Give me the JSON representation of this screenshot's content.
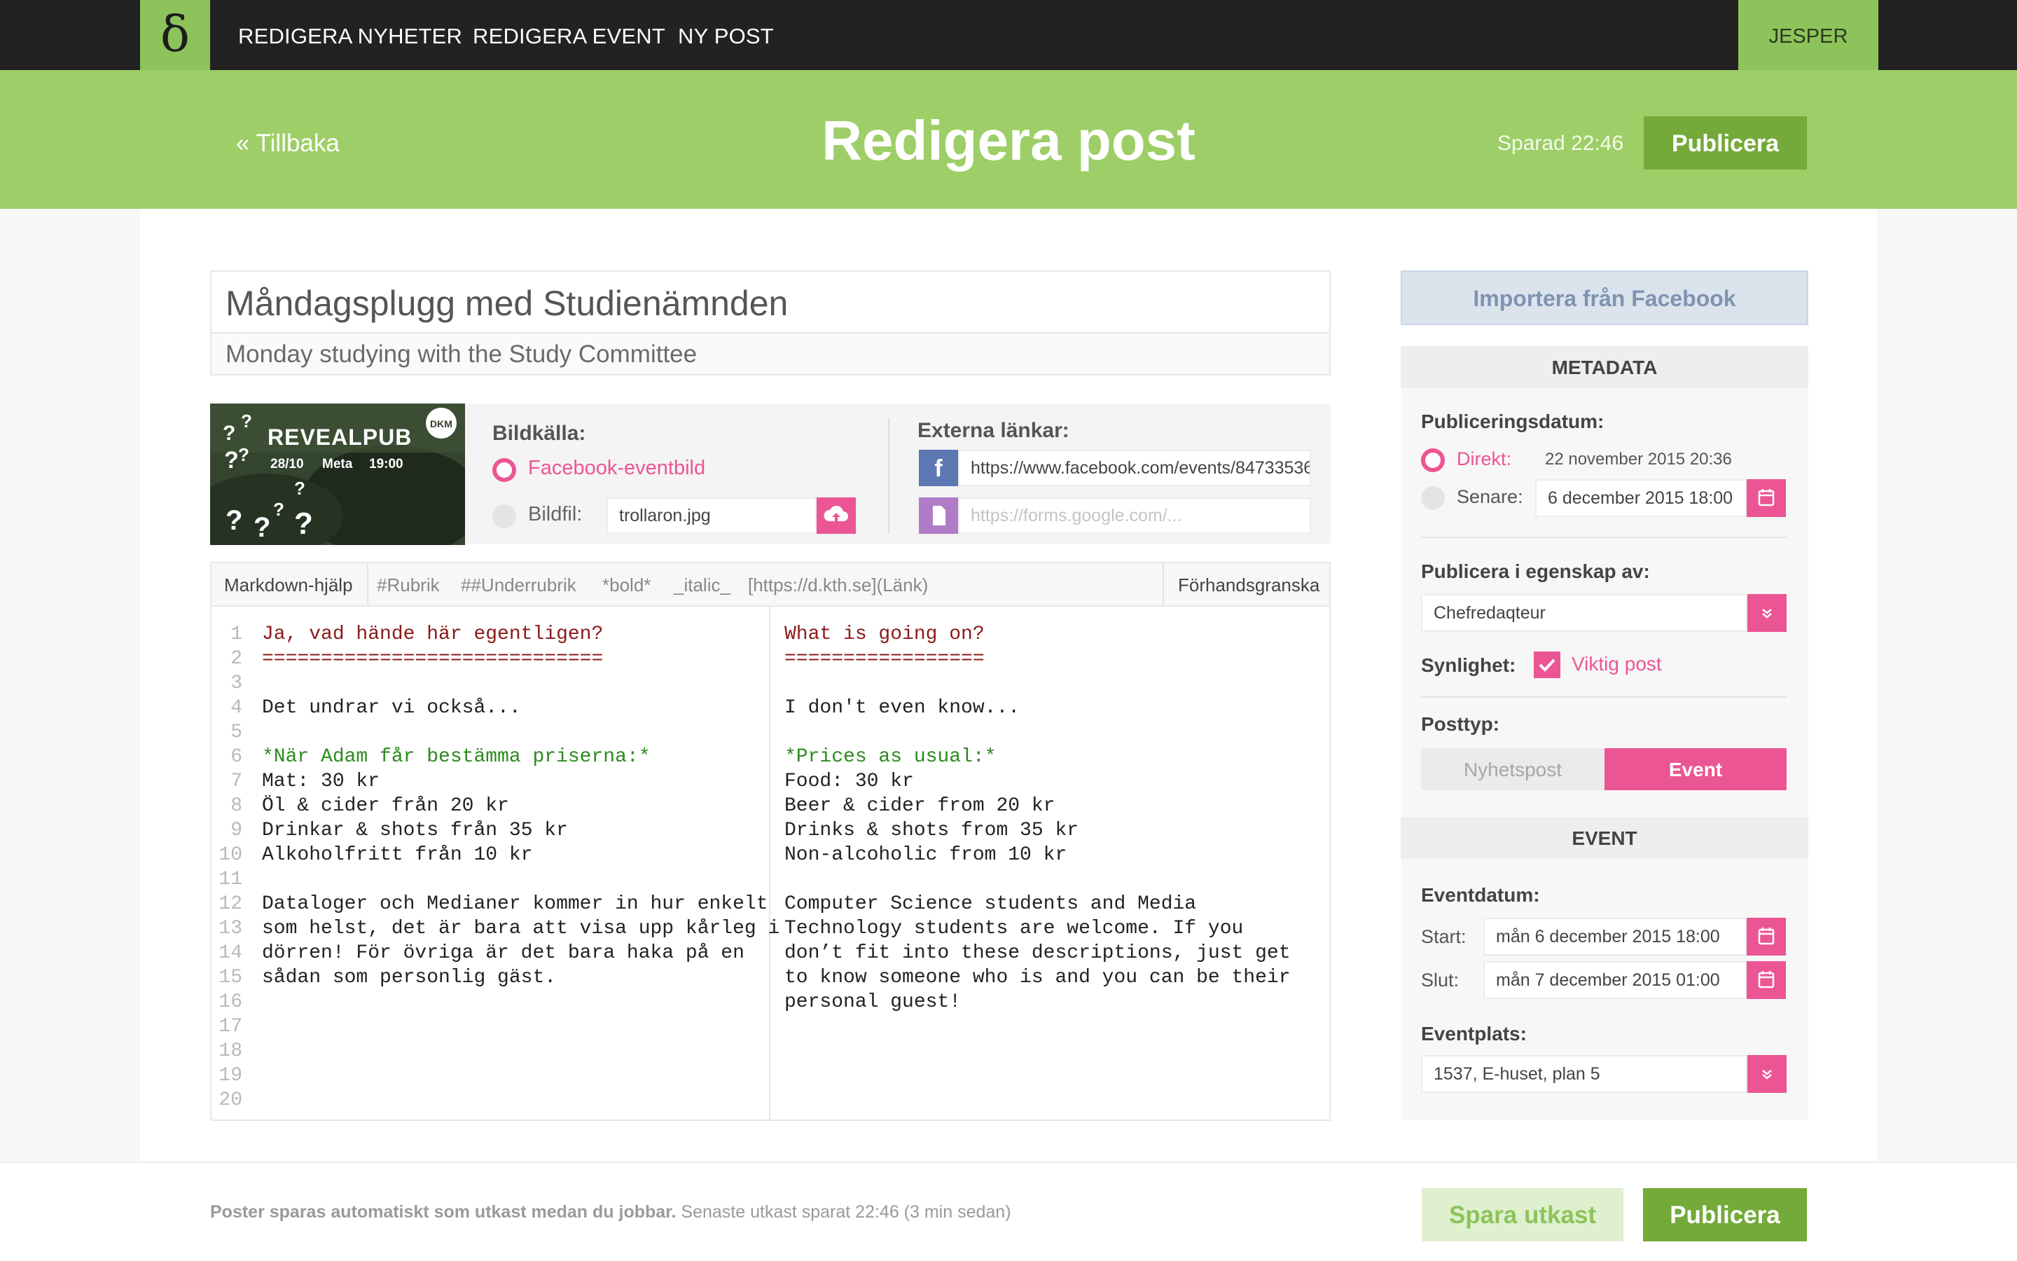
{
  "nav": {
    "logo": "δ",
    "links": [
      "REDIGERA NYHETER",
      "REDIGERA EVENT",
      "NY POST"
    ],
    "user": "JESPER"
  },
  "header": {
    "back": "« Tillbaka",
    "title": "Redigera post",
    "saved": "Sparad 22:46",
    "publish": "Publicera"
  },
  "post": {
    "title_sv": "Måndagsplugg med Studienämnden",
    "title_en": "Monday studying with the Study Committee"
  },
  "image": {
    "banner_text": "REVEALPUB",
    "banner_date": "28/10",
    "banner_place": "Meta",
    "banner_time": "19:00",
    "badge": "DKM",
    "source_label": "Bildkälla:",
    "option_facebook": "Facebook-eventbild",
    "option_file": "Bildfil:",
    "file_value": "trollaron.jpg"
  },
  "links": {
    "label": "Externa länkar:",
    "facebook_value": "https://www.facebook.com/events/84733536",
    "other_placeholder": "https://forms.google.com/..."
  },
  "toolbar": {
    "help": "Markdown-hjälp",
    "heading": "#Rubrik",
    "subheading": "##Underrubrik",
    "bold": "*bold*",
    "italic": "_italic_",
    "link": "[https://d.kth.se](Länk)",
    "preview": "Förhandsgranska"
  },
  "editor": {
    "line_numbers": [
      "1",
      "2",
      "3",
      "4",
      "5",
      "6",
      "7",
      "8",
      "9",
      "10",
      "11",
      "12",
      "13",
      "14",
      "15",
      "16",
      "17",
      "18",
      "19",
      "20"
    ],
    "sv": [
      {
        "t": "Ja, vad hände här egentligen?",
        "c": "red"
      },
      {
        "t": "=============================",
        "c": "red"
      },
      {
        "t": "",
        "c": ""
      },
      {
        "t": "Det undrar vi också...",
        "c": ""
      },
      {
        "t": "",
        "c": ""
      },
      {
        "t": "*När Adam får bestämma priserna:*",
        "c": "grn"
      },
      {
        "t": "Mat: 30 kr",
        "c": ""
      },
      {
        "t": "Öl & cider från 20 kr",
        "c": ""
      },
      {
        "t": "Drinkar & shots från 35 kr",
        "c": ""
      },
      {
        "t": "Alkoholfritt från 10 kr",
        "c": ""
      },
      {
        "t": "",
        "c": ""
      },
      {
        "t": "Dataloger och Medianer kommer in hur enkelt",
        "c": ""
      },
      {
        "t": "som helst, det är bara att visa upp kårleg i",
        "c": ""
      },
      {
        "t": "dörren! För övriga är det bara haka på en",
        "c": ""
      },
      {
        "t": "sådan som personlig gäst.",
        "c": ""
      }
    ],
    "en": [
      {
        "t": "What is going on?",
        "c": "red"
      },
      {
        "t": "=================",
        "c": "red"
      },
      {
        "t": "",
        "c": ""
      },
      {
        "t": "I don't even know...",
        "c": ""
      },
      {
        "t": "",
        "c": ""
      },
      {
        "t": "*Prices as usual:*",
        "c": "grn"
      },
      {
        "t": "Food: 30 kr",
        "c": ""
      },
      {
        "t": "Beer & cider from 20 kr",
        "c": ""
      },
      {
        "t": "Drinks & shots from 35 kr",
        "c": ""
      },
      {
        "t": "Non-alcoholic from 10 kr",
        "c": ""
      },
      {
        "t": "",
        "c": ""
      },
      {
        "t": "Computer Science students and Media",
        "c": ""
      },
      {
        "t": "Technology students are welcome. If you",
        "c": ""
      },
      {
        "t": "don’t fit into these descriptions, just get",
        "c": ""
      },
      {
        "t": "to know someone who is and you can be their",
        "c": ""
      },
      {
        "t": "personal guest!",
        "c": ""
      }
    ]
  },
  "sidebar": {
    "import_fb": "Importera från Facebook",
    "metadata_title": "METADATA",
    "pubdate_label": "Publiceringsdatum:",
    "direct_label": "Direkt:",
    "direct_value": "22 november 2015 20:36",
    "later_label": "Senare:",
    "later_value": "6 december 2015 18:00",
    "role_label": "Publicera i egenskap av:",
    "role_value": "Chefredaqteur",
    "visibility_label": "Synlighet:",
    "important_label": "Viktig post",
    "posttype_label": "Posttyp:",
    "type_news": "Nyhetspost",
    "type_event": "Event",
    "event_title": "EVENT",
    "eventdate_label": "Eventdatum:",
    "start_label": "Start:",
    "start_value": "mån 6 december 2015 18:00",
    "end_label": "Slut:",
    "end_value": "mån 7 december 2015 01:00",
    "place_label": "Eventplats:",
    "place_value": "1537, E-huset, plan 5"
  },
  "footer": {
    "note_bold": "Poster sparas automatiskt som utkast medan du jobbar.",
    "note_rest": " Senaste utkast sparat 22:46 (3 min sedan)",
    "save_draft": "Spara utkast",
    "publish": "Publicera"
  },
  "colors": {
    "green": "#9ece67",
    "dark_green": "#74aa39",
    "pink": "#ec5593",
    "nav": "#222222"
  }
}
